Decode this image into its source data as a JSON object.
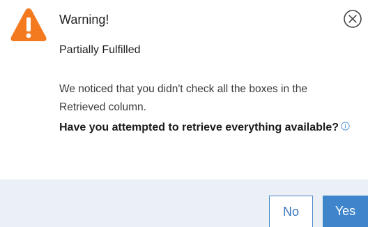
{
  "dialog": {
    "icon": "warning-triangle-icon",
    "title": "Warning!",
    "subtitle": "Partially Fulfilled",
    "message": "We noticed that you didn't check all the boxes in the Retrieved column.",
    "question": "Have you attempted to retrieve everything available?",
    "info_icon": "info-icon",
    "close_icon": "close-circle-icon",
    "buttons": {
      "no": "No",
      "yes": "Yes"
    }
  },
  "colors": {
    "warning": "#f47a20",
    "accent": "#3f85cc",
    "footer_bg": "#eaf0f6"
  }
}
